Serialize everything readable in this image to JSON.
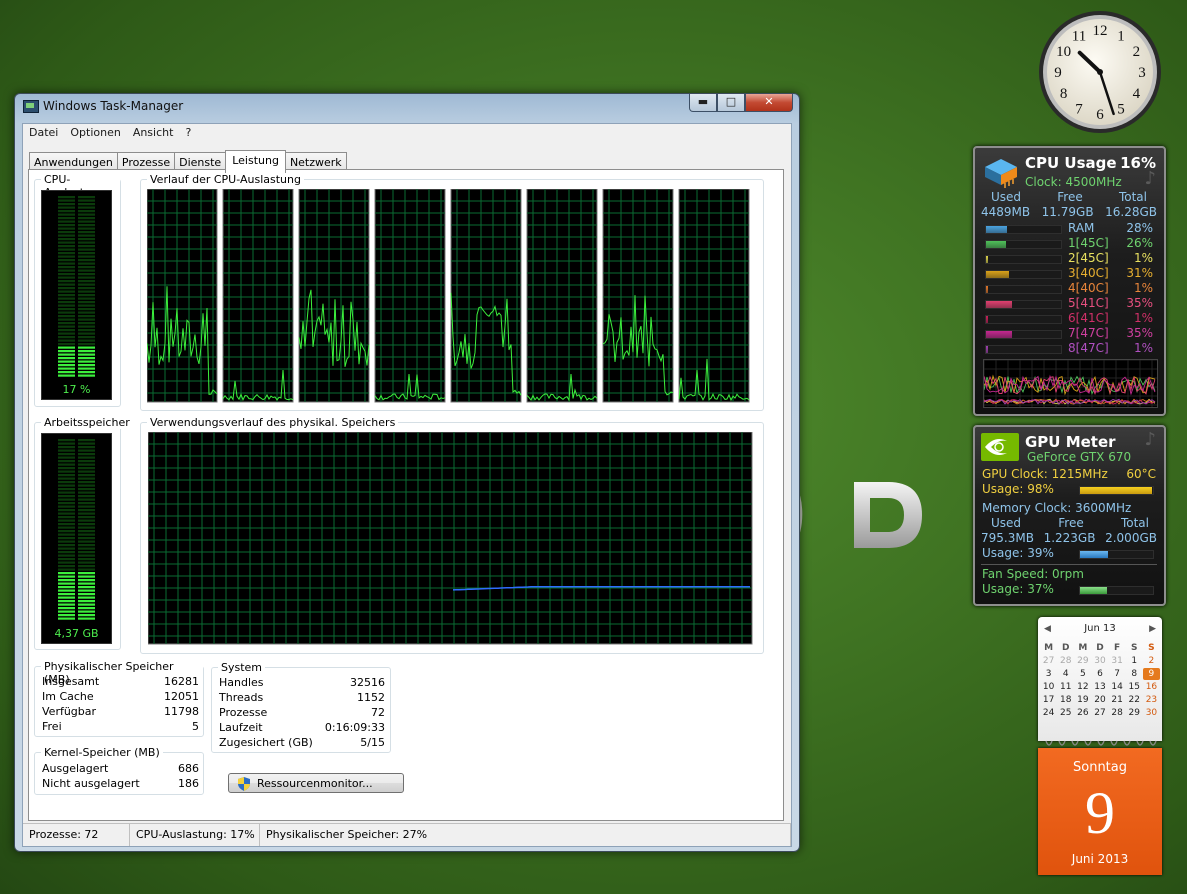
{
  "window": {
    "title": "Windows Task-Manager",
    "controls": {
      "minimize": "▬",
      "maximize": "□",
      "close": "✕"
    }
  },
  "menu": [
    "Datei",
    "Optionen",
    "Ansicht",
    "?"
  ],
  "tabs": [
    "Anwendungen",
    "Prozesse",
    "Dienste",
    "Leistung",
    "Netzwerk"
  ],
  "active_tab": "Leistung",
  "cpu": {
    "meter_title": "CPU-Auslastung",
    "meter_value": "17 %",
    "meter_level": 0.17,
    "history_title": "Verlauf der CPU-Auslastung",
    "core_count": 8
  },
  "memory": {
    "meter_title": "Arbeitsspeicher",
    "meter_value": "4,37 GB",
    "meter_level": 0.27,
    "history_title": "Verwendungsverlauf des physikal. Speichers"
  },
  "physical_memory": {
    "title": "Physikalischer Speicher (MB)",
    "rows": [
      {
        "label": "Insgesamt",
        "value": "16281"
      },
      {
        "label": "Im Cache",
        "value": "12051"
      },
      {
        "label": "Verfügbar",
        "value": "11798"
      },
      {
        "label": "Frei",
        "value": "5"
      }
    ]
  },
  "kernel_memory": {
    "title": "Kernel-Speicher (MB)",
    "rows": [
      {
        "label": "Ausgelagert",
        "value": "686"
      },
      {
        "label": "Nicht ausgelagert",
        "value": "186"
      }
    ]
  },
  "system": {
    "title": "System",
    "rows": [
      {
        "label": "Handles",
        "value": "32516"
      },
      {
        "label": "Threads",
        "value": "1152"
      },
      {
        "label": "Prozesse",
        "value": "72"
      },
      {
        "label": "Laufzeit",
        "value": "0:16:09:33"
      },
      {
        "label": "Zugesichert (GB)",
        "value": "5/15"
      }
    ]
  },
  "resource_monitor_button": "Ressourcenmonitor...",
  "statusbar": {
    "processes": "Prozesse: 72",
    "cpu": "CPU-Auslastung: 17%",
    "memory": "Physikalischer Speicher: 27%"
  },
  "cpu_gadget": {
    "title": "CPU Usage",
    "value": "16%",
    "clock": "Clock: 4500MHz",
    "headers": [
      "Used",
      "Free",
      "Total"
    ],
    "values": [
      "4489MB",
      "11.79GB",
      "16.28GB"
    ],
    "bars": [
      {
        "label": "RAM",
        "pct": "28%",
        "level": 0.28,
        "color": "#4aa3e0",
        "text_color": "#8fc4ea"
      },
      {
        "label": "1[45C]",
        "pct": "26%",
        "level": 0.26,
        "color": "#4fc15a",
        "text_color": "#6fd36f"
      },
      {
        "label": "2[45C]",
        "pct": "1%",
        "level": 0.01,
        "color": "#d9d14a",
        "text_color": "#e8e060"
      },
      {
        "label": "3[40C]",
        "pct": "31%",
        "level": 0.31,
        "color": "#d9a21a",
        "text_color": "#e8b030"
      },
      {
        "label": "4[40C]",
        "pct": "1%",
        "level": 0.01,
        "color": "#e0762a",
        "text_color": "#e8853a"
      },
      {
        "label": "5[41C]",
        "pct": "35%",
        "level": 0.35,
        "color": "#e04070",
        "text_color": "#e85080"
      },
      {
        "label": "6[41C]",
        "pct": "1%",
        "level": 0.01,
        "color": "#c8205a",
        "text_color": "#d03068"
      },
      {
        "label": "7[47C]",
        "pct": "35%",
        "level": 0.35,
        "color": "#c42890",
        "text_color": "#d040a0"
      },
      {
        "label": "8[47C]",
        "pct": "1%",
        "level": 0.01,
        "color": "#a040b0",
        "text_color": "#b050c0"
      }
    ]
  },
  "gpu_gadget": {
    "title": "GPU Meter",
    "model": "GeForce GTX 670",
    "gpu_clock": "GPU Clock: 1215MHz",
    "temp": "60°C",
    "usage": "Usage: 98%",
    "usage_level": 0.98,
    "mem_clock": "Memory Clock: 3600MHz",
    "headers": [
      "Used",
      "Free",
      "Total"
    ],
    "values": [
      "795.3MB",
      "1.223GB",
      "2.000GB"
    ],
    "mem_usage": "Usage: 39%",
    "mem_usage_level": 0.39,
    "fan": "Fan Speed: 0rpm",
    "fan_usage": "Usage: 37%",
    "fan_usage_level": 0.37
  },
  "calendar": {
    "month": "Jun 13",
    "weekday_headers": [
      "M",
      "D",
      "M",
      "D",
      "F",
      "S",
      "S"
    ],
    "days": [
      [
        "27",
        "28",
        "29",
        "30",
        "31",
        "1",
        "2"
      ],
      [
        "3",
        "4",
        "5",
        "6",
        "7",
        "8",
        "9"
      ],
      [
        "10",
        "11",
        "12",
        "13",
        "14",
        "15",
        "16"
      ],
      [
        "17",
        "18",
        "19",
        "20",
        "21",
        "22",
        "23"
      ],
      [
        "24",
        "25",
        "26",
        "27",
        "28",
        "29",
        "30"
      ]
    ],
    "today": "9",
    "weekday": "Sonntag",
    "month_year": "Juni 2013"
  },
  "clock": {
    "numerals": [
      "12",
      "1",
      "2",
      "3",
      "4",
      "5",
      "6",
      "7",
      "8",
      "9",
      "10",
      "11"
    ],
    "hour": 10,
    "minute": 27
  }
}
